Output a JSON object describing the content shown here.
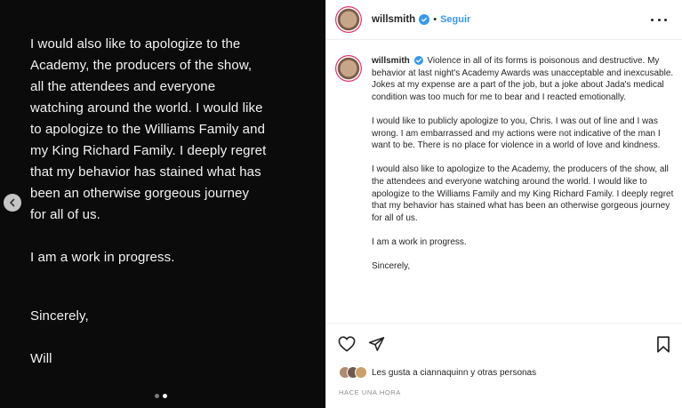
{
  "media": {
    "lines": [
      "I would also like to apologize to the",
      "Academy, the producers of the show,",
      "all the attendees and everyone",
      "watching around the world. I would like",
      "to apologize to the Williams Family and",
      "my King Richard Family. I deeply regret",
      "that my behavior has stained what has",
      "been an otherwise gorgeous journey",
      "for all of us."
    ],
    "progress": "I am a work in progress.",
    "sincerely": "Sincerely,",
    "signature": "Will",
    "carousel": {
      "total": 2,
      "active_index": 1
    },
    "icons": {
      "prev": "chevron-left-icon"
    }
  },
  "post": {
    "username": "willsmith",
    "separator": "•",
    "follow_label": "Seguir",
    "caption": {
      "username": "willsmith",
      "paragraph1": "Violence in all of its forms is poisonous and destructive. My behavior at last night's Academy Awards was unacceptable and inexcusable. Jokes at my expense are a part of the job, but a joke about Jada's medical condition was too much for me to bear and I reacted emotionally.",
      "paragraph2": "I would like to publicly apologize to you, Chris. I was out of line and I was wrong. I am embarrassed and my actions were not indicative of the man I want to be. There is no place for violence in a world of love and kindness.",
      "paragraph3": "I would also like to apologize to the Academy, the producers of the show, all the attendees and everyone watching around the world. I would like to apologize to the Williams Family and my King Richard Family. I deeply regret that my behavior has stained what has been an otherwise gorgeous journey for all of us.",
      "paragraph4": "I am a work in progress.",
      "paragraph5": "Sincerely,"
    },
    "likes_text": "Les gusta a ciannaquinn y otras personas",
    "timestamp": "HACE UNA HORA",
    "icons": {
      "verified": "verified-badge-icon",
      "more": "more-options-icon",
      "like": "heart-icon",
      "share": "share-icon",
      "save": "bookmark-icon"
    },
    "colors": {
      "link": "#3897f0",
      "text": "#262626",
      "muted": "#8e8e8e",
      "panel": "#0b0b0b"
    }
  }
}
